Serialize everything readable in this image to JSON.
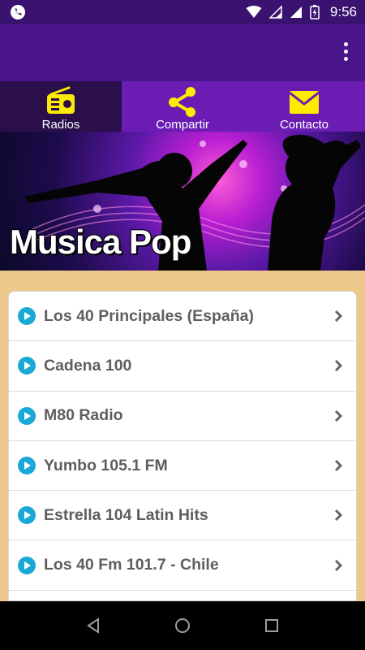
{
  "status_bar": {
    "time": "9:56",
    "icons": [
      "phone-call-icon",
      "wifi-icon",
      "signal-icon",
      "signal-icon",
      "battery-charging-icon"
    ]
  },
  "app_bar": {
    "menu_icon": "overflow-menu-icon"
  },
  "tabs": [
    {
      "label": "Radios",
      "icon": "radio-icon",
      "active": true
    },
    {
      "label": "Compartir",
      "icon": "share-icon",
      "active": false
    },
    {
      "label": "Contacto",
      "icon": "mail-icon",
      "active": false
    }
  ],
  "banner": {
    "title": "Musica Pop"
  },
  "stations": [
    {
      "name": "Los 40 Principales (España)"
    },
    {
      "name": "Cadena 100"
    },
    {
      "name": "M80 Radio"
    },
    {
      "name": "Yumbo 105.1 FM"
    },
    {
      "name": "Estrella 104 Latin Hits"
    },
    {
      "name": "Los 40 Fm 101.7 - Chile"
    }
  ],
  "nav_bar": {
    "icons": [
      "back-icon",
      "home-icon",
      "recents-icon"
    ]
  },
  "colors": {
    "status_bar": "#3a1270",
    "app_bar": "#4a148c",
    "tab_bar": "#6a1cb3",
    "tab_active": "#2a0f4a",
    "tab_icon": "#ffeb00",
    "play_icon": "#1aa9d6",
    "background": "#ecc98a"
  }
}
